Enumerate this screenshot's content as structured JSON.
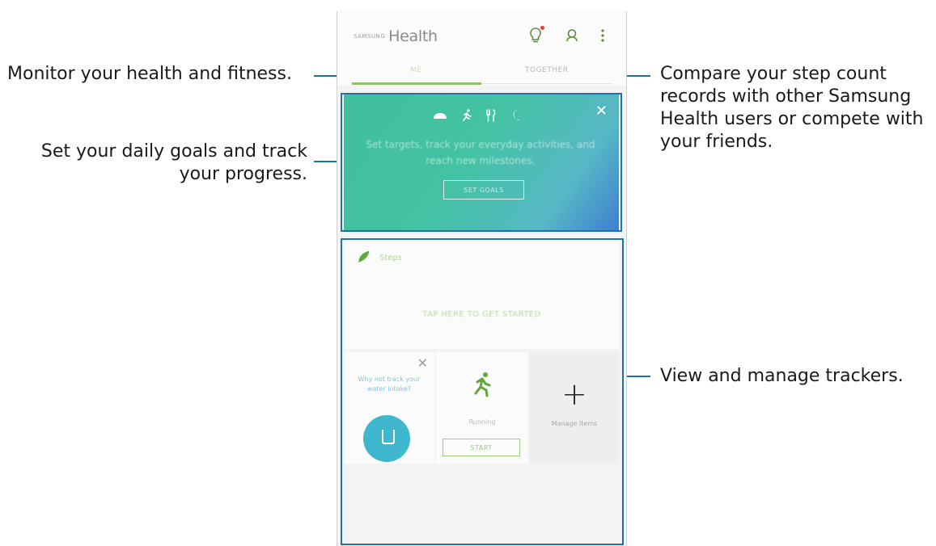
{
  "app": {
    "brand_small": "SAMSUNG",
    "brand_big": "Health",
    "tabs": [
      "ME",
      "TOGETHER"
    ]
  },
  "goals_card": {
    "text": "Set targets, track your everyday activities, and reach new milestones.",
    "button": "SET GOALS",
    "close": "✕"
  },
  "steps_card": {
    "title": "Steps",
    "cta": "TAP HERE TO GET STARTED"
  },
  "tiles": {
    "water_prompt": "Why not track your water intake?",
    "close": "✕",
    "running_label": "Running",
    "running_button": "START",
    "manage_label": "Manage items",
    "add_symbol": "+"
  },
  "callouts": {
    "monitor": "Monitor your health and fitness.",
    "goals": "Set your daily goals and track your progress.",
    "compare": "Compare your step count records with other Samsung Health users or compete with your friends.",
    "trackers": "View and manage trackers."
  },
  "icons": {
    "bulb": "bulb-icon",
    "profile": "profile-icon",
    "more": "more-icon",
    "shoe": "shoe-icon",
    "run": "run-icon",
    "food": "food-icon",
    "moon": "moon-icon"
  },
  "colors": {
    "callout_line": "#1f72a8",
    "accent_green": "#8cc46a",
    "water_blue": "#3fb7cf"
  }
}
